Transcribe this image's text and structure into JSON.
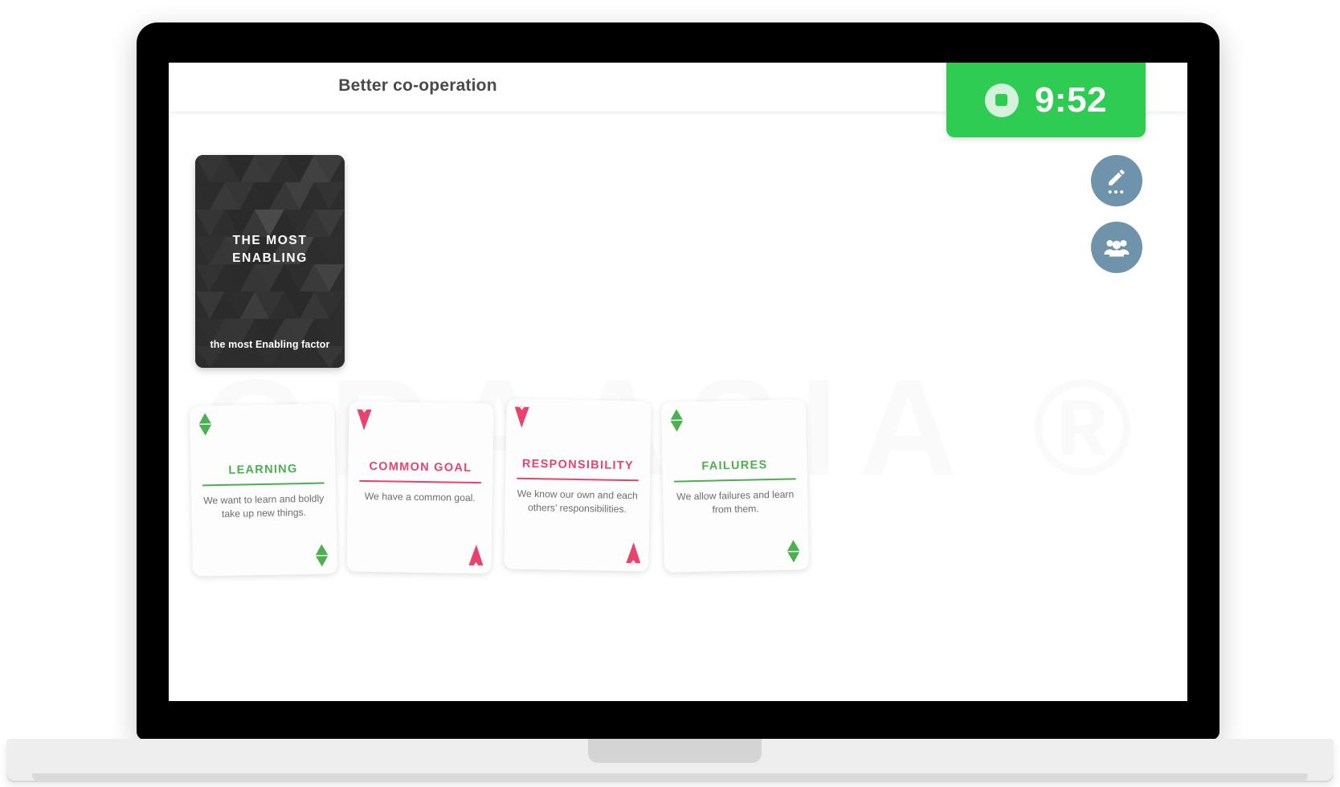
{
  "header": {
    "title": "Better co-operation"
  },
  "timer": {
    "value": "9:52",
    "icon": "stop-circle-icon",
    "background_color": "#2fcc53",
    "text_color": "#ffffff"
  },
  "actions": [
    {
      "name": "edit-button",
      "icon": "pencil-icon",
      "secondary_glyph": "•••",
      "color": "#6f93aa"
    },
    {
      "name": "participants-button",
      "icon": "people-group-icon",
      "color": "#6f93aa"
    }
  ],
  "background": {
    "watermark_text": "GRAASIA ®",
    "watermark_color": "#fafafa"
  },
  "enabling_card": {
    "title": "THE MOST\nENABLING",
    "title_line1": "THE MOST",
    "title_line2": "ENABLING",
    "caption": "the most Enabling factor",
    "background_color": "#2d2d2d",
    "text_color": "#ffffff"
  },
  "colors": {
    "green": "#4caf50",
    "pink": "#e8436f",
    "card_bg": "#fdfdfd",
    "body_text": "#6d6d6d"
  },
  "cards": [
    {
      "title": "LEARNING",
      "body": "We want to learn and boldly take up new things.",
      "accent": "#4caf50",
      "marker": "diamond",
      "marker_name": "green-diamond-marker"
    },
    {
      "title": "COMMON GOAL",
      "body": "We have a common goal.",
      "accent": "#e8436f",
      "marker": "triangle-down",
      "marker_name": "pink-triangle-marker"
    },
    {
      "title": "RESPONSIBILITY",
      "body": "We know our own and each others’ responsibilities.",
      "accent": "#e8436f",
      "marker": "triangle-down",
      "marker_name": "pink-triangle-marker"
    },
    {
      "title": "FAILURES",
      "body": "We allow failures and learn from them.",
      "accent": "#4caf50",
      "marker": "diamond",
      "marker_name": "green-diamond-marker"
    }
  ]
}
